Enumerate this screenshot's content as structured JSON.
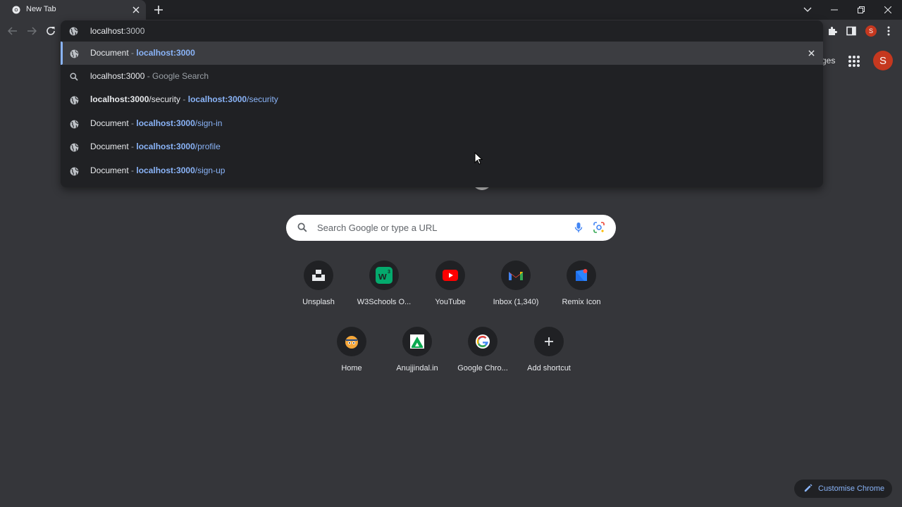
{
  "tab": {
    "title": "New Tab"
  },
  "omnibox": {
    "typed": "localhost",
    "inline_completion": ":3000",
    "suggestions": [
      {
        "content": "Document",
        "separator": " - ",
        "url_bold": "localhost:3000",
        "url_rest": ""
      },
      {
        "content": "localhost:3000",
        "description": " - Google Search"
      },
      {
        "content_bold": "localhost:3000",
        "content_rest": "/security",
        "separator": " - ",
        "url_bold": "localhost:3000",
        "url_rest": "/security"
      },
      {
        "content": "Document",
        "separator": " - ",
        "url_bold": "localhost:3000",
        "url_rest": "/sign-in"
      },
      {
        "content": "Document",
        "separator": " - ",
        "url_bold": "localhost:3000",
        "url_rest": "/profile"
      },
      {
        "content": "Document",
        "separator": " - ",
        "url_bold": "localhost:3000",
        "url_rest": "/sign-up"
      }
    ]
  },
  "profile": {
    "initial": "S"
  },
  "ntp": {
    "images_partial": "ges",
    "search_placeholder": "Search Google or type a URL",
    "shortcuts": [
      {
        "label": "Unsplash",
        "icon": "unsplash-icon"
      },
      {
        "label": "W3Schools O...",
        "icon": "w3schools-icon"
      },
      {
        "label": "YouTube",
        "icon": "youtube-icon"
      },
      {
        "label": "Inbox (1,340)",
        "icon": "gmail-icon"
      },
      {
        "label": "Remix Icon",
        "icon": "remix-icon"
      },
      {
        "label": "Home",
        "icon": "home-site-icon"
      },
      {
        "label": "Anujjindal.in",
        "icon": "anujjindal-icon"
      },
      {
        "label": "Google Chro...",
        "icon": "google-icon"
      },
      {
        "label": "Add shortcut",
        "icon": "plus-icon"
      }
    ],
    "customise_label": "Customise Chrome"
  },
  "colors": {
    "accent": "#8ab4f8",
    "background": "#35363a",
    "avatar": "#c5381f"
  }
}
